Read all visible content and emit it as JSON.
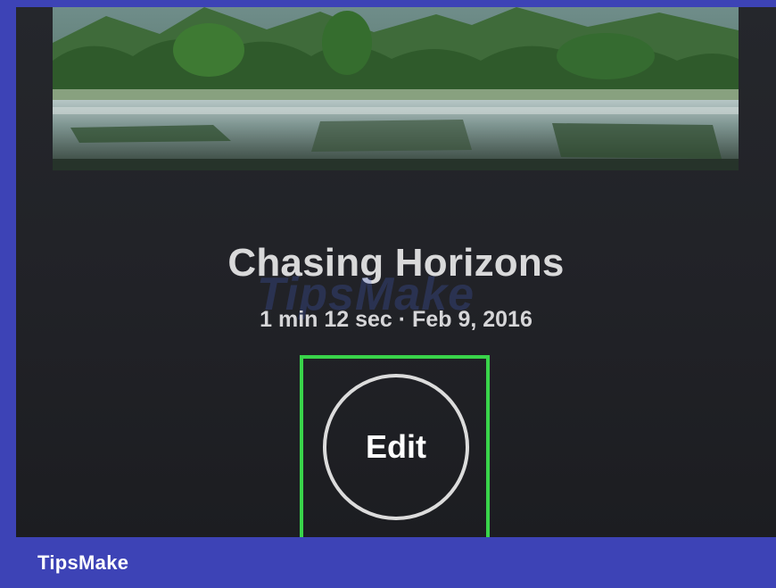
{
  "video": {
    "title": "Chasing Horizons",
    "meta": "1 min 12 sec · Feb 9, 2016",
    "thumbnail_icon": "landscape-river-icon"
  },
  "actions": {
    "edit_label": "Edit"
  },
  "overlay": {
    "watermark": "TipsMake",
    "brand": "TipsMake"
  },
  "colors": {
    "frame": "#3d43b6",
    "screen_bg": "#222328",
    "highlight": "#39d44a",
    "text": "#d9d9da"
  }
}
